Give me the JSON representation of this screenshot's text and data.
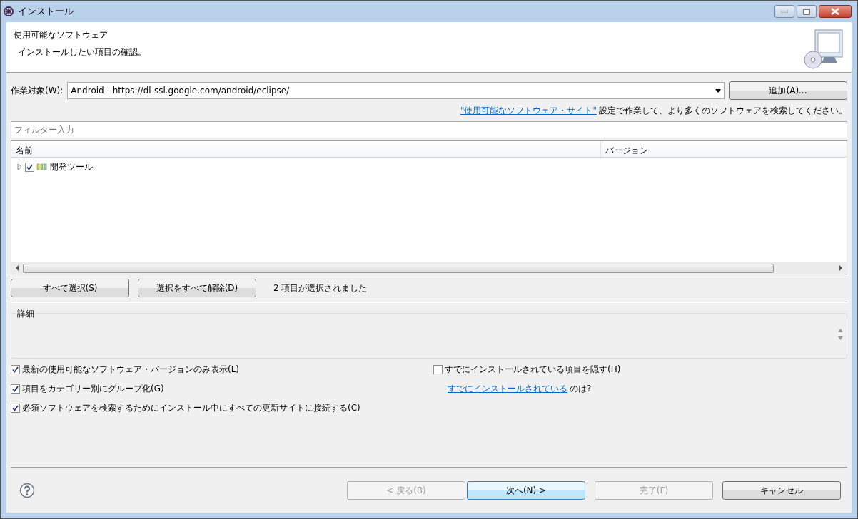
{
  "window": {
    "title": "インストール"
  },
  "header": {
    "title": "使用可能なソフトウェア",
    "description": "インストールしたい項目の確認。"
  },
  "work_with": {
    "label": "作業対象(W):",
    "value": "Android - https://dl-ssl.google.com/android/eclipse/",
    "add_button": "追加(A)..."
  },
  "sites_hint": {
    "link": "\"使用可能なソフトウェア・サイト\"",
    "text": "設定で作業して、より多くのソフトウェアを検索してください。"
  },
  "filter": {
    "placeholder": "フィルター入力"
  },
  "tree": {
    "columns": [
      "名前",
      "バージョン"
    ],
    "items": [
      {
        "label": "開発ツール",
        "checked": true,
        "expanded": false
      }
    ]
  },
  "selection_buttons": [
    "すべて選択(S)",
    "選択をすべて解除(D)"
  ],
  "selection_status": "2 項目が選択されました",
  "details": {
    "title": "詳細"
  },
  "left_options": [
    {
      "label": "最新の使用可能なソフトウェア・バージョンのみ表示(L)",
      "checked": true
    },
    {
      "label": "項目をカテゴリー別にグループ化(G)",
      "checked": true
    },
    {
      "label": "必須ソフトウェアを検索するためにインストール中にすべての更新サイトに接続する(C)",
      "checked": true
    }
  ],
  "right_options": [
    {
      "label": "すでにインストールされている項目を隠す(H)",
      "checked": false
    }
  ],
  "installed_hint": {
    "link": "すでにインストールされている",
    "text": "のは?"
  },
  "footer_buttons": [
    {
      "label": "< 戻る(B)",
      "disabled": true,
      "default": false
    },
    {
      "label": "次へ(N) >",
      "disabled": false,
      "default": true
    },
    {
      "label": "完了(F)",
      "disabled": true,
      "default": false
    },
    {
      "label": "キャンセル",
      "disabled": false,
      "default": false
    }
  ]
}
